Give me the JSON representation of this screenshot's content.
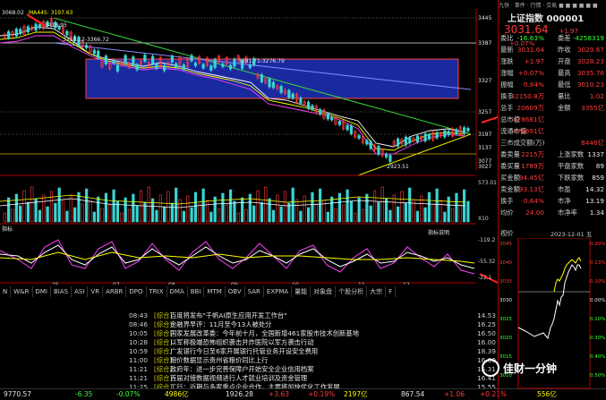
{
  "top_label": {
    "ma5": "3068.02",
    "ma445": "MA445: 3197.63"
  },
  "price_axis": [
    "3445",
    "3387",
    "3327",
    "3257",
    "3197",
    "3137",
    "3077",
    "3027"
  ],
  "annotations": {
    "high": "3418.95",
    "h2": "3356.12-3366.72",
    "h3": "3281.71-3276.79",
    "low": "2923.51"
  },
  "volume_axis": [
    "573.01",
    "X10"
  ],
  "macd_axis": [
    "-119.2",
    "-55.32",
    "-22.1"
  ],
  "macd_label": "指标说明",
  "date_axis": [
    "25",
    "07",
    "08",
    "09",
    "10",
    "11",
    "12"
  ],
  "indicator_tabs": [
    "N",
    "W&R",
    "DMI",
    "BIAS",
    "ASI",
    "VR",
    "ARBR",
    "DPO",
    "TRIX",
    "DMA",
    "BBI",
    "MTM",
    "OBV",
    "SAR",
    "EXPMA",
    "量能",
    "对象盘",
    "个股分析",
    "大宗",
    "F"
  ],
  "news": [
    {
      "time": "08:43",
      "src": "[综合]",
      "text": "百度将发布\"千帆AI原生应用开发工作台\"",
      "num": "14.53"
    },
    {
      "time": "08:46",
      "src": "[综合]",
      "text": "金融界早评：11月至今13人被处分",
      "num": "16.25"
    },
    {
      "time": "10:05",
      "src": "[综合]",
      "text": "国家发展改革委：今年前十月，全国新增461家股市技术创新基地",
      "num": "16.50"
    },
    {
      "time": "10:28",
      "src": "[综合]",
      "text": "以军称极端恐怖组织袭击并炸医院以军方袭击行动",
      "num": "16.00"
    },
    {
      "time": "10:59",
      "src": "[综合]",
      "text": "广发银行今日至6家开展银行托管业务开设安全费用",
      "num": "18.39"
    },
    {
      "time": "11:00",
      "src": "[综合]",
      "text": "粮价数据显示贵州省粮价同比上行",
      "num": "16.00"
    },
    {
      "time": "11:21",
      "src": "[综合]",
      "text": "政府年：进一步完善保障户开始安全企业信用档案",
      "num": "15.31"
    },
    {
      "time": "11:21",
      "src": "[综合]",
      "text": "首届对接数据视频进行人才就业培训及资金管理",
      "num": "16.41"
    },
    {
      "time": "11:25",
      "src": "[综合]",
      "text": "工行：近期与多家重点企业合作，主要将加快优化工作发展",
      "num": "15.55"
    }
  ],
  "status": [
    {
      "text": "9770.57",
      "cls": "wht"
    },
    {
      "text": "-6.35",
      "cls": "grn"
    },
    {
      "text": "-0.07%",
      "cls": "grn"
    },
    {
      "text": "4986亿",
      "cls": "yel"
    },
    {
      "text": "1926.28",
      "cls": "wht"
    },
    {
      "text": "+3.63",
      "cls": "red"
    },
    {
      "text": "+0.19%",
      "cls": "red"
    },
    {
      "text": "2197亿",
      "cls": "yel"
    },
    {
      "text": "867.54",
      "cls": "wht"
    },
    {
      "text": "+1.06",
      "cls": "red"
    },
    {
      "text": "+0.21%",
      "cls": "red"
    },
    {
      "text": "556亿",
      "cls": "yel"
    }
  ],
  "right": {
    "title": "上证指数 000001",
    "price": "3031.64",
    "chg": "+1.97",
    "pct": "+0.07%",
    "rows": [
      [
        "委比",
        "-16.63%",
        "委差",
        "-4258319"
      ],
      [
        "最新",
        "3031.64",
        "昨收",
        "3029.67"
      ],
      [
        "涨跌",
        "+1.97",
        "开盘",
        "3028.23"
      ],
      [
        "涨幅",
        "+0.07%",
        "最高",
        "3035.76"
      ],
      [
        "振幅",
        "0.84%",
        "最低",
        "3010.23"
      ],
      [
        "换手",
        "32150.8万",
        "量比",
        "1.02"
      ],
      [
        "总手",
        "20609万",
        "金额",
        "3355亿"
      ],
      [
        "总市值",
        "478681亿",
        "",
        ""
      ],
      [
        "流通市值",
        "478691亿",
        "",
        ""
      ],
      [
        "三市成交额(万)",
        "",
        "",
        "8446亿"
      ],
      [
        "委卖量",
        "2215万",
        "上涨家数",
        "1337"
      ],
      [
        "委买量",
        "1789万",
        "平盘家数",
        "89"
      ],
      [
        "买金额",
        "94.45亿",
        "下跌家数",
        "859"
      ],
      [
        "卖金额",
        "93.13亿",
        "市盈",
        "14.32"
      ],
      [
        "换手",
        "0.64%",
        "市净",
        "13.19"
      ],
      [
        "均价",
        "24.00",
        "市净率",
        "1.34"
      ]
    ],
    "mini_title": "视价",
    "mini_date": "2023-12-01 五",
    "mini_axis": [
      "3045",
      "3040",
      "3035",
      "3030",
      "3025",
      "3020",
      "3015",
      "3010"
    ],
    "mini_pct": [
      "0.20%",
      "0.13%",
      "0.10%",
      "0.00%",
      "0.10%",
      "0.30%",
      "0.40%",
      "0.50%"
    ]
  },
  "logo_text": "佳财一分钟"
}
